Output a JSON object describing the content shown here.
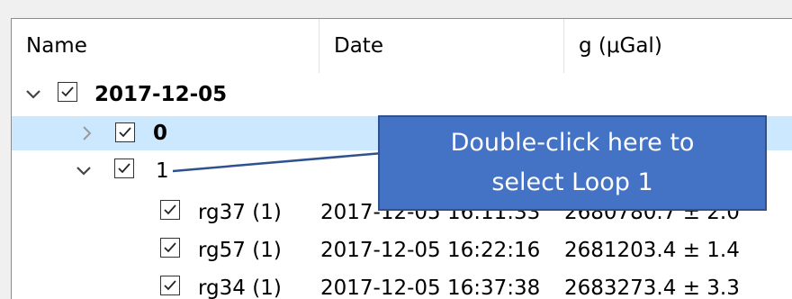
{
  "columns": {
    "name": "Name",
    "date": "Date",
    "g": "g (μGal)"
  },
  "tree": {
    "root": {
      "label": "2017-12-05",
      "checked": true,
      "expanded": true
    },
    "loop0": {
      "label": "0",
      "checked": true,
      "expanded": false
    },
    "loop1": {
      "label": "1",
      "checked": true,
      "expanded": true
    },
    "stations": [
      {
        "name": "rg37 (1)",
        "date": "2017-12-05 16:11:33",
        "g": "2680780.7 ± 2.0"
      },
      {
        "name": "rg57 (1)",
        "date": "2017-12-05 16:22:16",
        "g": "2681203.4 ± 1.4"
      },
      {
        "name": "rg34 (1)",
        "date": "2017-12-05 16:37:38",
        "g": "2683273.4 ± 3.3"
      }
    ]
  },
  "callout": {
    "line1": "Double-click here to",
    "line2": "select Loop 1"
  },
  "colors": {
    "selection": "#cce8ff",
    "focus": "#a8c5e0",
    "callout": "#4472c4"
  }
}
